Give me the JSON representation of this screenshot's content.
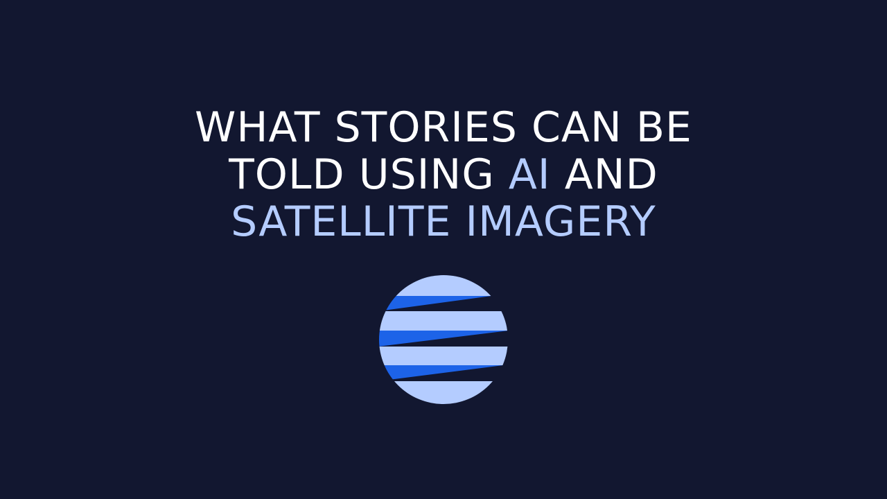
{
  "headline": {
    "line1": "WHAT STORIES CAN BE",
    "line2_before": "TOLD USING ",
    "line2_highlight": "AI",
    "line2_after": " AND",
    "line3_highlight": "SATELLITE IMAGERY"
  },
  "colors": {
    "background": "#121730",
    "text": "#ffffff",
    "highlight": "#b4ccff",
    "logo_light": "#b4ccff",
    "logo_blue": "#1d63e8"
  },
  "logo": {
    "icon": "striped-globe-icon"
  }
}
